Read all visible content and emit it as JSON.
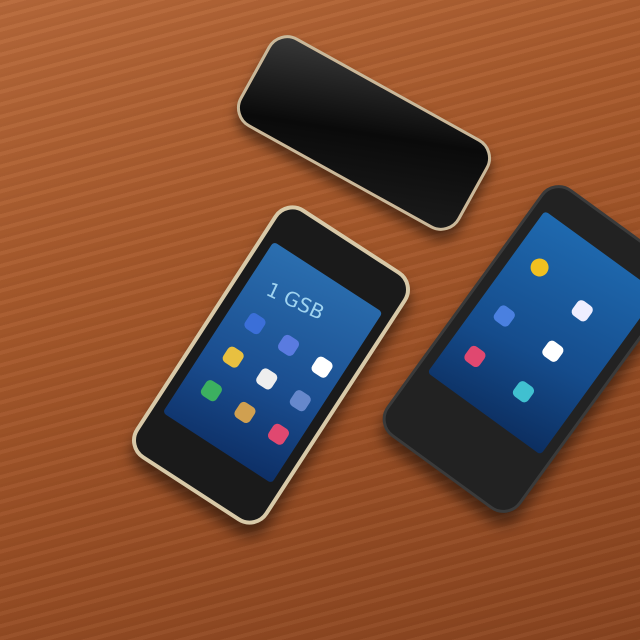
{
  "scene": {
    "description_free": true,
    "phone_screen": {
      "clock_text": "1 GSB"
    },
    "colors": {
      "table": "#a85a2c",
      "screen": "#1a4d8f"
    }
  }
}
